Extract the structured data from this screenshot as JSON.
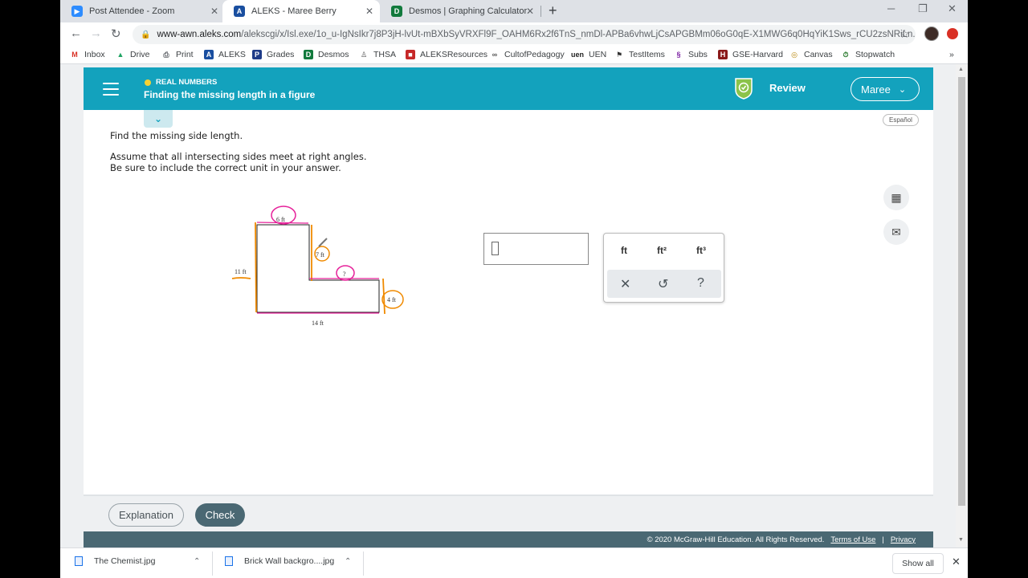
{
  "tabs": [
    {
      "title": "Post Attendee - Zoom",
      "icon": "zoom-icon",
      "color": "#2d8cff"
    },
    {
      "title": "ALEKS - Maree Berry",
      "icon": "aleks-icon",
      "color": "#1a4fa0"
    },
    {
      "title": "Desmos | Graphing Calculator",
      "icon": "desmos-icon",
      "color": "#127a3d"
    }
  ],
  "window_controls": {
    "minimize": "─",
    "restore": "❐",
    "close": "✕"
  },
  "address": {
    "host": "www-awn.aleks.com",
    "path": "/alekscgi/x/Isl.exe/1o_u-IgNsIkr7j8P3jH-lvUt-mBXbSyVRXFl9F_OAHM6Rx2f6TnS_nmDl-APBa6vhwLjCsAPGBMm06oG0qE-X1MWG6q0HqYiK1Sws_rCU2zsNRiLn..."
  },
  "bookmarks": [
    {
      "label": "Inbox",
      "icon": "gmail-icon"
    },
    {
      "label": "Drive",
      "icon": "drive-icon"
    },
    {
      "label": "Print",
      "icon": "print-icon"
    },
    {
      "label": "ALEKS",
      "icon": "aleks-icon"
    },
    {
      "label": "Grades",
      "icon": "grades-icon"
    },
    {
      "label": "Desmos",
      "icon": "desmos-icon"
    },
    {
      "label": "THSA",
      "icon": "thsa-icon"
    },
    {
      "label": "ALEKSResources",
      "icon": "resources-icon"
    },
    {
      "label": "CultofPedagogy",
      "icon": "link-icon"
    },
    {
      "label": "UEN",
      "icon": "uen-icon"
    },
    {
      "label": "TestItems",
      "icon": "flag-icon"
    },
    {
      "label": "Subs",
      "icon": "subs-icon"
    },
    {
      "label": "GSE-Harvard",
      "icon": "harvard-icon"
    },
    {
      "label": "Canvas",
      "icon": "canvas-icon"
    },
    {
      "label": "Stopwatch",
      "icon": "stopwatch-icon"
    }
  ],
  "bookmarks_more": "»",
  "aleks": {
    "topic_category": "REAL NUMBERS",
    "topic_title": "Finding the missing length in a figure",
    "review_label": "Review",
    "user_label": "Maree",
    "espanol_label": "Español",
    "prompt_line1": "Find the missing side length.",
    "prompt_line2": "Assume that all intersecting sides meet at right angles.",
    "prompt_line3": "Be sure to include the correct unit in your answer.",
    "figure": {
      "label_top": "6 ft",
      "label_right_upper": "7 ft",
      "label_unknown": "?",
      "label_left": "11 ft",
      "label_right_lower": "4 ft",
      "label_bottom": "14 ft"
    },
    "unit_keys": [
      "ft",
      "ft²",
      "ft³"
    ],
    "control_keys": {
      "clear": "✕",
      "undo": "↺",
      "help": "?"
    },
    "explanation_label": "Explanation",
    "check_label": "Check",
    "copyright": "© 2020 McGraw-Hill Education. All Rights Reserved.",
    "terms_label": "Terms of Use",
    "privacy_label": "Privacy"
  },
  "downloads": [
    {
      "name": "The Chemist.jpg"
    },
    {
      "name": "Brick Wall backgro....jpg"
    }
  ],
  "show_all_label": "Show all",
  "colors": {
    "aleks_header": "#13a2bd",
    "check_button": "#4a6873",
    "annotation_pink": "#e6219a",
    "annotation_orange": "#f08a00"
  }
}
